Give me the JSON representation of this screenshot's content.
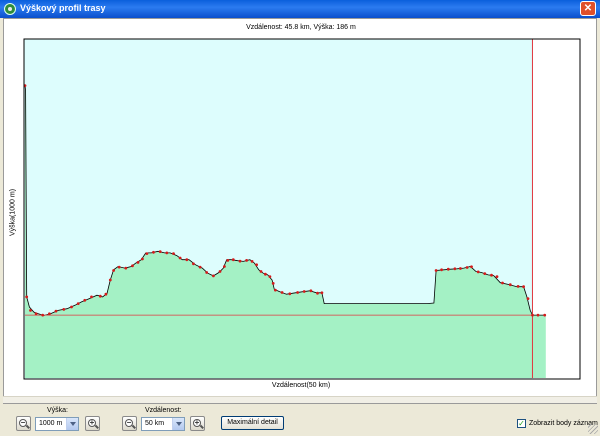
{
  "window": {
    "title": "Výškový profil trasy",
    "close_label": "✕"
  },
  "plot": {
    "info": "Vzdálenost: 45.8 km, Výška: 186 m",
    "xlabel": "Vzdálenost(50 km)",
    "ylabel": "Výška(1000 m)",
    "colors": {
      "sky": "#ddfdfd",
      "terrain": "#a4f1c5",
      "profile_line": "#000000",
      "points": "#d41b1b",
      "cursor_line": "#e0373e",
      "ref_line": "#e0373e"
    },
    "chart_data": {
      "type": "area",
      "x_range_km": [
        0,
        50
      ],
      "y_range_m": [
        0,
        1000
      ],
      "cursor_km": 45.8,
      "cursor_height_m": 186,
      "profile": [
        [
          0.0,
          865
        ],
        [
          0.05,
          850
        ],
        [
          0.15,
          240
        ],
        [
          0.4,
          210
        ],
        [
          0.8,
          195
        ],
        [
          1.2,
          190
        ],
        [
          1.7,
          185
        ],
        [
          2.3,
          190
        ],
        [
          3.0,
          200
        ],
        [
          3.8,
          205
        ],
        [
          4.5,
          215
        ],
        [
          5.1,
          225
        ],
        [
          5.8,
          235
        ],
        [
          6.5,
          245
        ],
        [
          7.0,
          240
        ],
        [
          7.4,
          250
        ],
        [
          7.7,
          290
        ],
        [
          8.0,
          320
        ],
        [
          8.4,
          330
        ],
        [
          9.0,
          325
        ],
        [
          9.6,
          330
        ],
        [
          10.0,
          340
        ],
        [
          10.5,
          350
        ],
        [
          10.9,
          370
        ],
        [
          11.4,
          370
        ],
        [
          12.0,
          375
        ],
        [
          12.6,
          370
        ],
        [
          13.1,
          370
        ],
        [
          13.7,
          362
        ],
        [
          14.2,
          350
        ],
        [
          14.8,
          350
        ],
        [
          15.4,
          335
        ],
        [
          16.0,
          325
        ],
        [
          16.5,
          310
        ],
        [
          17.0,
          302
        ],
        [
          17.5,
          312
        ],
        [
          17.9,
          325
        ],
        [
          18.2,
          350
        ],
        [
          18.6,
          350
        ],
        [
          19.2,
          347
        ],
        [
          19.7,
          345
        ],
        [
          20.3,
          350
        ],
        [
          20.7,
          340
        ],
        [
          21.1,
          320
        ],
        [
          21.5,
          310
        ],
        [
          21.9,
          305
        ],
        [
          22.3,
          290
        ],
        [
          22.5,
          262
        ],
        [
          23.0,
          255
        ],
        [
          23.6,
          248
        ],
        [
          24.4,
          252
        ],
        [
          25.0,
          255
        ],
        [
          25.7,
          258
        ],
        [
          26.3,
          252
        ],
        [
          26.8,
          252
        ],
        [
          27.0,
          220
        ],
        [
          27.5,
          220
        ],
        [
          28.2,
          220
        ],
        [
          29.0,
          220
        ],
        [
          30.0,
          220
        ],
        [
          31.0,
          220
        ],
        [
          32.0,
          220
        ],
        [
          33.5,
          220
        ],
        [
          34.8,
          220
        ],
        [
          35.5,
          220
        ],
        [
          36.3,
          220
        ],
        [
          36.9,
          222
        ],
        [
          37.1,
          318
        ],
        [
          37.8,
          320
        ],
        [
          38.4,
          322
        ],
        [
          39.0,
          323
        ],
        [
          39.6,
          325
        ],
        [
          40.2,
          330
        ],
        [
          40.7,
          315
        ],
        [
          41.2,
          312
        ],
        [
          41.8,
          305
        ],
        [
          42.3,
          303
        ],
        [
          42.9,
          282
        ],
        [
          43.6,
          277
        ],
        [
          44.4,
          270
        ],
        [
          45.0,
          270
        ],
        [
          45.3,
          240
        ],
        [
          45.6,
          200
        ],
        [
          45.8,
          186
        ],
        [
          46.5,
          186
        ],
        [
          47.0,
          186
        ]
      ],
      "marker_km": [
        [
          0.0,
          865
        ],
        [
          0.15,
          240
        ],
        [
          0.5,
          200
        ],
        [
          1.0,
          190
        ],
        [
          1.6,
          186
        ],
        [
          2.2,
          190
        ],
        [
          2.8,
          198
        ],
        [
          3.5,
          203
        ],
        [
          4.2,
          210
        ],
        [
          4.8,
          220
        ],
        [
          5.4,
          230
        ],
        [
          6.0,
          240
        ],
        [
          6.8,
          242
        ],
        [
          7.3,
          248
        ],
        [
          7.7,
          290
        ],
        [
          8.0,
          318
        ],
        [
          8.5,
          328
        ],
        [
          9.1,
          325
        ],
        [
          9.7,
          332
        ],
        [
          10.2,
          342
        ],
        [
          10.6,
          352
        ],
        [
          11.0,
          368
        ],
        [
          11.6,
          372
        ],
        [
          12.2,
          374
        ],
        [
          12.8,
          370
        ],
        [
          13.4,
          368
        ],
        [
          14.0,
          355
        ],
        [
          14.6,
          350
        ],
        [
          15.2,
          338
        ],
        [
          15.8,
          328
        ],
        [
          16.4,
          312
        ],
        [
          17.0,
          302
        ],
        [
          17.6,
          315
        ],
        [
          18.0,
          330
        ],
        [
          18.3,
          348
        ],
        [
          18.8,
          350
        ],
        [
          19.4,
          346
        ],
        [
          20.0,
          348
        ],
        [
          20.5,
          345
        ],
        [
          20.9,
          335
        ],
        [
          21.3,
          315
        ],
        [
          21.7,
          307
        ],
        [
          22.1,
          300
        ],
        [
          22.4,
          280
        ],
        [
          22.6,
          260
        ],
        [
          23.2,
          253
        ],
        [
          23.9,
          249
        ],
        [
          24.6,
          253
        ],
        [
          25.2,
          256
        ],
        [
          25.8,
          258
        ],
        [
          26.4,
          251
        ],
        [
          26.8,
          252
        ],
        [
          37.1,
          318
        ],
        [
          37.6,
          320
        ],
        [
          38.2,
          322
        ],
        [
          38.8,
          323
        ],
        [
          39.3,
          324
        ],
        [
          39.9,
          327
        ],
        [
          40.3,
          329
        ],
        [
          40.9,
          314
        ],
        [
          41.5,
          309
        ],
        [
          42.1,
          304
        ],
        [
          42.6,
          300
        ],
        [
          43.1,
          281
        ],
        [
          43.8,
          276
        ],
        [
          44.5,
          271
        ],
        [
          45.0,
          270
        ],
        [
          45.4,
          235
        ],
        [
          45.8,
          186
        ],
        [
          46.3,
          186
        ],
        [
          46.9,
          186
        ]
      ]
    }
  },
  "controls": {
    "height_label": "Výška:",
    "height_value": "1000 m",
    "distance_label": "Vzdálenost:",
    "distance_value": "50 km",
    "max_detail_label": "Maximální detail",
    "show_points_label": "Zobrazit body záznam",
    "show_points_checked": "✓"
  }
}
